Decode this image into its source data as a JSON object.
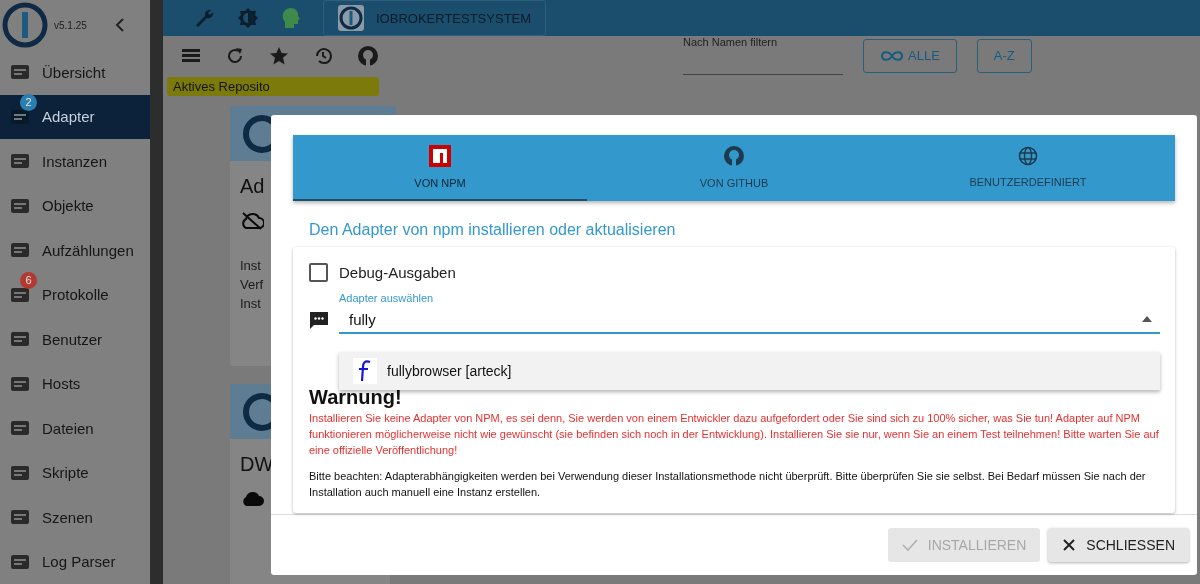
{
  "sidebar": {
    "version": "v5.1.25",
    "items": [
      {
        "label": "Übersicht",
        "selected": false
      },
      {
        "label": "Adapter",
        "selected": true,
        "badge": {
          "text": "2",
          "color": "#2a7fb0"
        }
      },
      {
        "label": "Instanzen",
        "selected": false
      },
      {
        "label": "Objekte",
        "selected": false
      },
      {
        "label": "Aufzählungen",
        "selected": false
      },
      {
        "label": "Protokolle",
        "selected": false,
        "badge": {
          "text": "6",
          "color": "#b03a32"
        }
      },
      {
        "label": "Benutzer",
        "selected": false
      },
      {
        "label": "Hosts",
        "selected": false
      },
      {
        "label": "Dateien",
        "selected": false
      },
      {
        "label": "Skripte",
        "selected": false
      },
      {
        "label": "Szenen",
        "selected": false
      },
      {
        "label": "Log Parser",
        "selected": false
      }
    ]
  },
  "topbar": {
    "system_name": "IOBROKERTESTSYSTEM"
  },
  "toolbar": {
    "filter_label": "Nach Namen filtern",
    "buttons": [
      "ALLE",
      "A-Z"
    ]
  },
  "repository_tag": "Aktives Reposito",
  "cards": [
    {
      "title": "Ad",
      "cloud_connected": false,
      "lines": [
        "Inst",
        "Verf",
        "Inst"
      ]
    },
    {
      "title": "DW",
      "cloud_connected": true
    }
  ],
  "dialog": {
    "tabs": [
      {
        "label": "VON NPM",
        "selected": true
      },
      {
        "label": "VON GITHUB",
        "selected": false
      },
      {
        "label": "BENUTZERDEFINIERT",
        "selected": false
      }
    ],
    "heading": "Den Adapter von npm installieren oder aktualisieren",
    "debug": {
      "label": "Debug-Ausgaben",
      "checked": false
    },
    "select": {
      "label": "Adapter auswählen",
      "value": "fully",
      "open": true
    },
    "options": [
      {
        "label": "fullybrowser [arteck]"
      }
    ],
    "warning_title": "Warnung!",
    "warning_text": "Installieren Sie keine Adapter von NPM, es sei denn, Sie werden von einem Entwickler dazu aufgefordert oder Sie sind sich zu 100% sicher, was Sie tun! Adapter auf NPM funktionieren möglicherweise nicht wie gewünscht (sie befinden sich noch in der Entwicklung). Installieren Sie sie nur, wenn Sie an einem Test teilnehmen! Bitte warten Sie auf eine offizielle Veröffentlichung!",
    "note": "Bitte beachten: Adapterabhängigkeiten werden bei Verwendung dieser Installationsmethode nicht überprüft. Bitte überprüfen Sie sie selbst. Bei Bedarf müssen Sie nach der Installation auch manuell eine Instanz erstellen.",
    "buttons": [
      {
        "label": "INSTALLIEREN",
        "disabled": true,
        "kind": "install"
      },
      {
        "label": "SCHLIESSEN",
        "disabled": false,
        "kind": "close"
      }
    ]
  }
}
